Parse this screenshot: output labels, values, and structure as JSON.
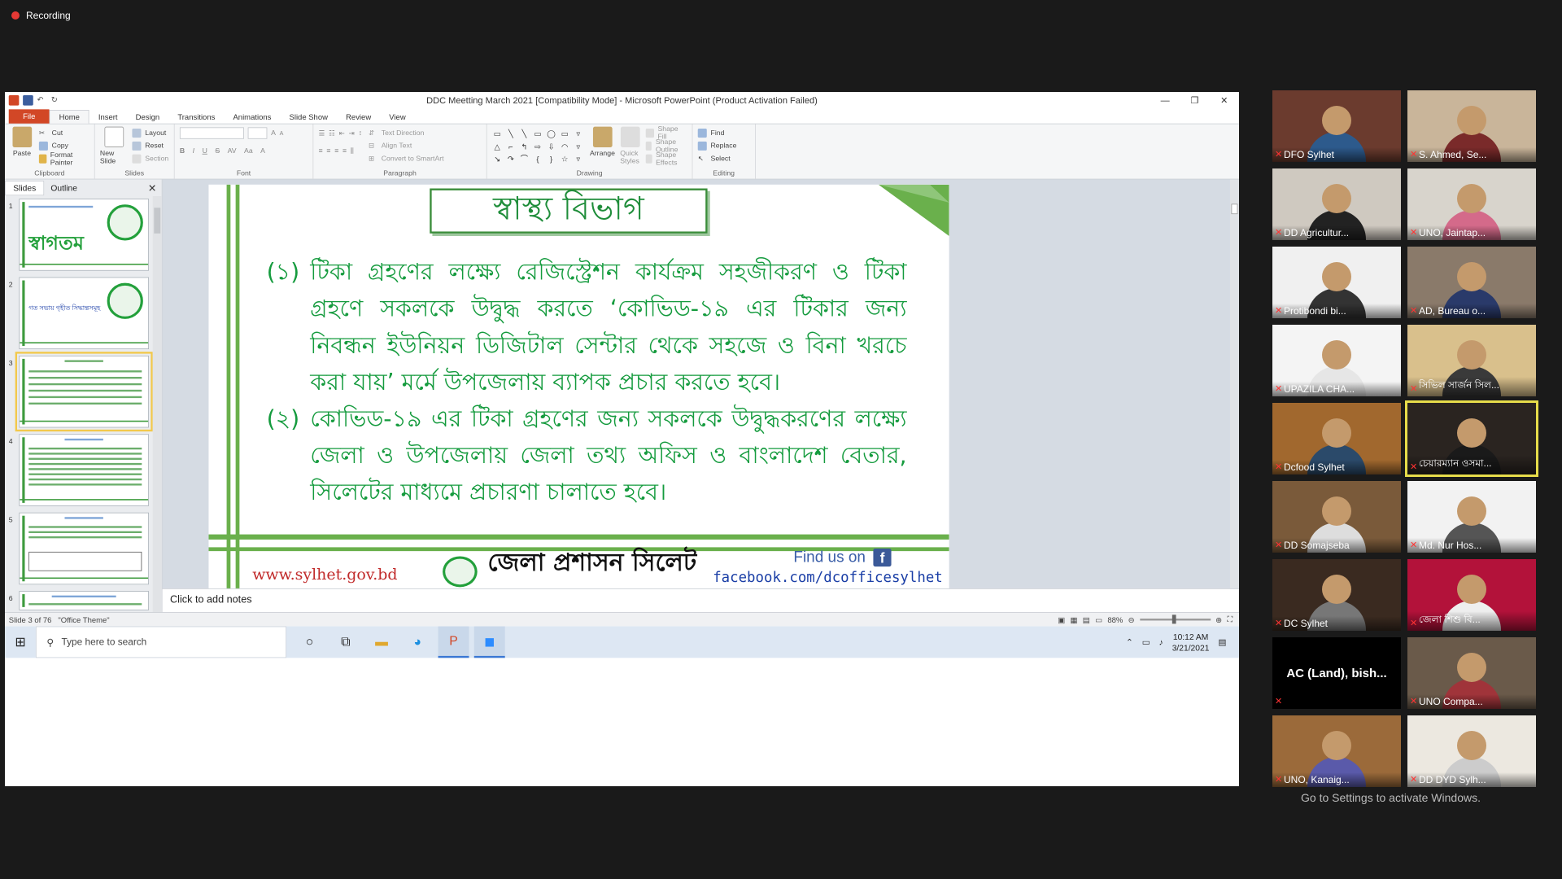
{
  "recording": {
    "label": "Recording"
  },
  "app": {
    "title": "DDC Meetting March 2021 [Compatibility Mode] - Microsoft PowerPoint (Product Activation Failed)",
    "tabs": [
      "File",
      "Home",
      "Insert",
      "Design",
      "Transitions",
      "Animations",
      "Slide Show",
      "Review",
      "View"
    ],
    "active_tab": "Home"
  },
  "ribbon": {
    "clipboard": {
      "paste": "Paste",
      "cut": "Cut",
      "copy": "Copy",
      "format_painter": "Format Painter",
      "name": "Clipboard"
    },
    "slides": {
      "new_slide": "New Slide",
      "layout": "Layout",
      "reset": "Reset",
      "section": "Section",
      "name": "Slides"
    },
    "font": {
      "name": "Font"
    },
    "paragraph": {
      "text_direction": "Text Direction",
      "align_text": "Align Text",
      "convert_smartart": "Convert to SmartArt",
      "name": "Paragraph"
    },
    "drawing": {
      "arrange": "Arrange",
      "quick_styles": "Quick Styles",
      "shape_fill": "Shape Fill",
      "shape_outline": "Shape Outline",
      "shape_effects": "Shape Effects",
      "name": "Drawing"
    },
    "editing": {
      "find": "Find",
      "replace": "Replace",
      "select": "Select",
      "name": "Editing"
    }
  },
  "left_panel": {
    "tabs": [
      "Slides",
      "Outline"
    ],
    "thumb1_text": "স্বাগতম",
    "thumb2_text": "গত সভায় গৃহীত সিদ্ধান্তসমূহ"
  },
  "slide": {
    "title": "স্বাস্থ্য বিভাগ",
    "points": [
      {
        "num": "(১)",
        "text": "টিকা গ্রহণের লক্ষ্যে রেজিস্ট্রেশন কার্যক্রম সহজীকরণ ও টিকা গ্রহণে সকলকে উদ্বুদ্ধ করতে ‘কোভিড-১৯ এর টিকার জন্য নিবন্ধন ইউনিয়ন ডিজিটাল সেন্টার থেকে সহজে ও বিনা খরচে করা যায়’ মর্মে উপজেলায় ব্যাপক প্রচার করতে হবে।"
      },
      {
        "num": "(২)",
        "text": "কোভিড-১৯ এর টিকা গ্রহণের জন্য সকলকে উদ্বুদ্ধকরণের লক্ষ্যে জেলা ও উপজেলায় জেলা তথ্য অফিস ও বাংলাদেশ বেতার, সিলেটের মাধ্যমে প্রচারণা চালাতে হবে।"
      }
    ],
    "footer_url": "www.sylhet.gov.bd",
    "footer_org": "জেলা প্রশাসন সিলেট",
    "find_us": "Find us on",
    "fb_url": "facebook.com/dcofficesylhet"
  },
  "notes_placeholder": "Click to add notes",
  "status": {
    "slide_info": "Slide 3 of 76",
    "theme": "\"Office Theme\"",
    "zoom": "88%"
  },
  "taskbar": {
    "search_placeholder": "Type here to search",
    "time": "10:12 AM",
    "date": "3/21/2021"
  },
  "participants": [
    "DFO Sylhet",
    "S. Ahmed, Se...",
    "DD Agricultur...",
    "UNO, Jaintap...",
    "Protibondi bi...",
    "AD, Bureau o...",
    "UPAZILA CHA...",
    "সিভিল সার্জন সিল...",
    "Dcfood Sylhet",
    "চেয়ারম্যান ওসমা...",
    "DD Somajseba",
    "Md. Nur Hos...",
    "DC Sylhet",
    "জেলা শিশু বি...",
    "AC (Land), bish...",
    "UNO Compa...",
    "UNO, Kanaig...",
    "DD DYD Sylh..."
  ],
  "activate_windows": "Go to Settings to activate Windows.",
  "colors": {
    "slide_green": "#159b3e",
    "accent_bar": "#6ab04c",
    "file_tab": "#d24726"
  },
  "slide_numbers": [
    "1",
    "2",
    "3",
    "4",
    "5",
    "6"
  ]
}
